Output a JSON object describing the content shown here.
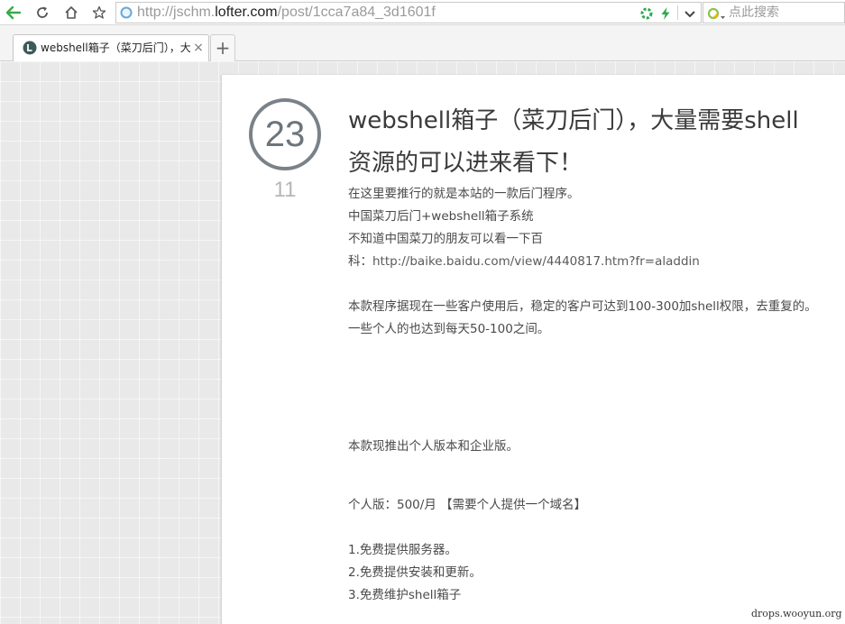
{
  "browser": {
    "url": {
      "prefix": "http://jschm.",
      "domain": "lofter.com",
      "path": "/post/1cca7a84_3d1601f"
    },
    "search": {
      "placeholder": "点此搜索"
    },
    "tab": {
      "title": "webshell箱子（菜刀后门），大量需要shell资源的可以进来看下！",
      "close_glyph": "×"
    },
    "new_tab_glyph": "+"
  },
  "post": {
    "date": {
      "day": "23",
      "month": "11"
    },
    "title": "webshell箱子（菜刀后门），大量需要shell资源的可以进来看下！",
    "body": {
      "line1": "在这里要推行的就是本站的一款后门程序。",
      "line2": "中国菜刀后门+webshell箱子系统",
      "line3": "不知道中国菜刀的朋友可以看一下百",
      "line4_prefix": "科：",
      "line4_link": "http://baike.baidu.com/view/4440817.htm?fr=aladdin",
      "para2": "本款程序据现在一些客户使用后，稳定的客户可达到100-300加shell权限，去重复的。一些个人的也达到每天50-100之间。",
      "para3": "本款现推出个人版本和企业版。",
      "personal_version": "个人版：500/月 【需要个人提供一个域名】",
      "list": [
        "1.免费提供服务器。",
        "2.免费提供安装和更新。",
        "3.免费维护shell箱子"
      ]
    }
  },
  "watermark": "drops.wooyun.org",
  "colors": {
    "date_circle": "#7a8289",
    "month_text": "#b3b7ba",
    "back_arrow": "#3aa94a",
    "lightning": "#2fa84f"
  }
}
